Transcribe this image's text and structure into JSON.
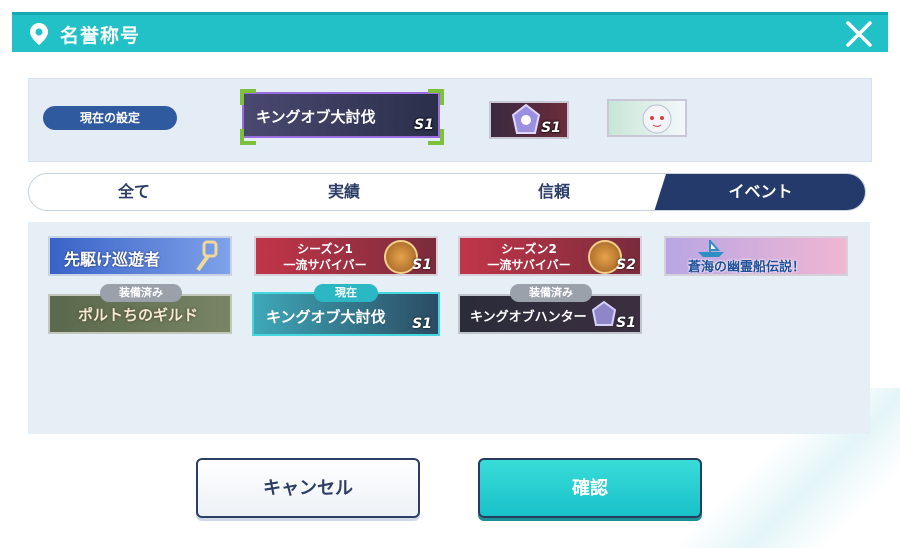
{
  "header": {
    "title": "名誉称号",
    "pin_icon": "location-pin-icon",
    "close_icon": "close-icon"
  },
  "current": {
    "label": "現在の設定",
    "main_title": "キングオブ大討伐",
    "main_season": "S1",
    "second_season": "S1"
  },
  "tabs": [
    {
      "label": "全て",
      "active": false
    },
    {
      "label": "実績",
      "active": false
    },
    {
      "label": "信頼",
      "active": false
    },
    {
      "label": "イベント",
      "active": true
    }
  ],
  "items": [
    {
      "title": "先駆け巡遊者"
    },
    {
      "title": "シーズン1\n一流サバイバー",
      "season": "S1"
    },
    {
      "title": "シーズン2\n一流サバイバー",
      "season": "S2"
    },
    {
      "title": "蒼海の幽霊船伝説！"
    },
    {
      "title": "ポルトちのギルド",
      "tag": "装備済み"
    },
    {
      "title": "キングオブ大討伐",
      "season": "S1",
      "tag": "現在"
    },
    {
      "title": "キングオブハンター",
      "season": "S1",
      "tag": "装備済み"
    }
  ],
  "buttons": {
    "cancel": "キャンセル",
    "confirm": "確認"
  },
  "colors": {
    "accent": "#22c1c8",
    "navy": "#233a6a",
    "panel": "#e6eff6"
  }
}
